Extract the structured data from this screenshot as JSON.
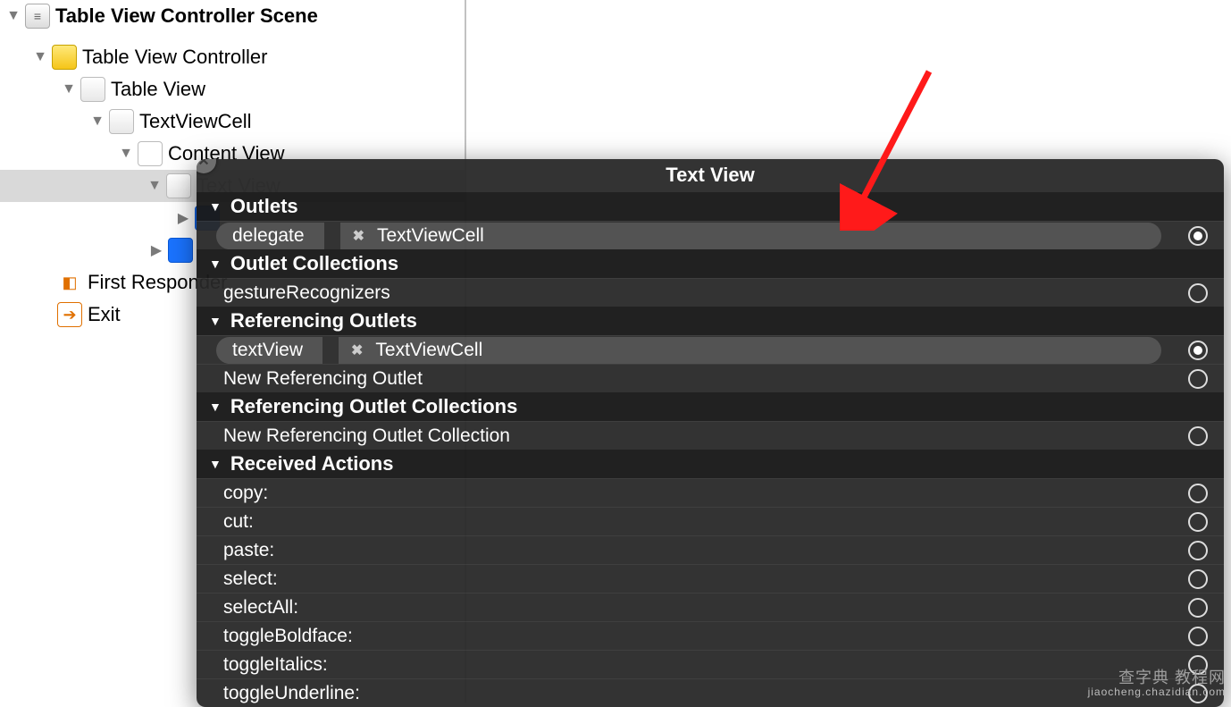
{
  "outline": {
    "scene": "Table View Controller Scene",
    "vc": "Table View Controller",
    "tableview": "Table View",
    "cell": "TextViewCell",
    "contentview": "Content View",
    "textview_obscured": "Text View",
    "first_responder": "First Responder",
    "exit": "Exit"
  },
  "hud": {
    "title": "Text View",
    "sections": {
      "outlets": "Outlets",
      "outlet_collections": "Outlet Collections",
      "referencing_outlets": "Referencing Outlets",
      "referencing_outlet_collections": "Referencing Outlet Collections",
      "received_actions": "Received Actions"
    },
    "rows": {
      "delegate": {
        "label": "delegate",
        "dest": "TextViewCell"
      },
      "gestureRecognizers": "gestureRecognizers",
      "textView": {
        "label": "textView",
        "dest": "TextViewCell"
      },
      "new_ref_outlet": "New Referencing Outlet",
      "new_ref_outlet_coll": "New Referencing Outlet Collection",
      "actions": [
        "copy:",
        "cut:",
        "paste:",
        "select:",
        "selectAll:",
        "toggleBoldface:",
        "toggleItalics:",
        "toggleUnderline:"
      ]
    }
  },
  "watermark": {
    "line1": "查字典 教程网",
    "line2": "jiaocheng.chazidian.com"
  }
}
